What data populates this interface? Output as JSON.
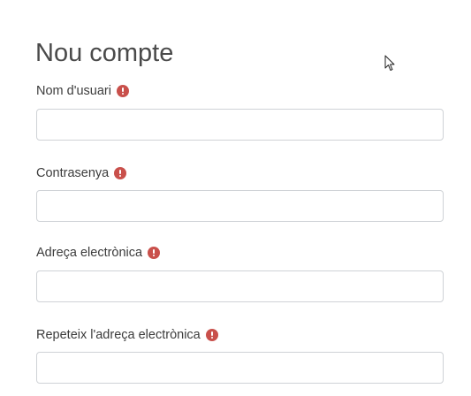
{
  "form": {
    "title": "Nou compte",
    "fields": [
      {
        "label": "Nom d'usuari",
        "value": "",
        "placeholder": "",
        "required_icon": "exclamation-circle-icon"
      },
      {
        "label": "Contrasenya",
        "value": "",
        "placeholder": "",
        "required_icon": "exclamation-circle-icon"
      },
      {
        "label": "Adreça electrònica",
        "value": "",
        "placeholder": "",
        "required_icon": "exclamation-circle-icon"
      },
      {
        "label": "Repeteix l'adreça electrònica",
        "value": "",
        "placeholder": "",
        "required_icon": "exclamation-circle-icon"
      }
    ]
  },
  "colors": {
    "required_icon": "#c9504b",
    "input_border": "#cfd2d6",
    "title_text": "#4a4a4a",
    "label_text": "#3c3c3c"
  },
  "cursor": {
    "icon": "mouse-pointer-icon"
  }
}
